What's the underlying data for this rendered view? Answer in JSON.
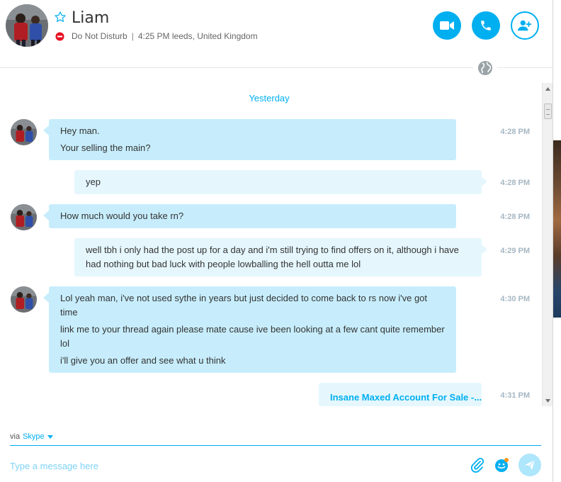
{
  "header": {
    "contact_name": "Liam",
    "status": "Do Not Disturb",
    "separator": "|",
    "local_time": "4:25 PM leeds, United Kingdom",
    "icons": {
      "favorite": "star-outline-icon",
      "status": "do-not-disturb-icon",
      "video": "video-camera-icon",
      "call": "phone-icon",
      "add_people": "add-person-icon",
      "globe": "globe-icon"
    }
  },
  "conversation": {
    "day_label": "Yesterday",
    "messages": [
      {
        "from": "Liam",
        "lines": [
          "Hey man.",
          "Your selling the main?"
        ],
        "time": "4:28 PM"
      },
      {
        "from": "me",
        "lines": [
          "yep"
        ],
        "time": "4:28 PM"
      },
      {
        "from": "Liam",
        "lines": [
          "How much would you take rn?"
        ],
        "time": "4:28 PM"
      },
      {
        "from": "me",
        "lines": [
          "well tbh i only had the post up for a day and i'm still trying to find offers on it, although i have had nothing but bad luck with people lowballing the hell outta me lol"
        ],
        "time": "4:29 PM"
      },
      {
        "from": "Liam",
        "lines": [
          "Lol yeah man, i've not used sythe in years but just decided to come back to rs now i've got time",
          "link me to your thread again please mate cause ive been looking at a few cant quite remember lol",
          "i'll give you an offer and see what u think"
        ],
        "time": "4:30 PM"
      },
      {
        "from": "me",
        "lines": [
          "Insane Maxed Account For Sale -..."
        ],
        "time": "4:31 PM"
      }
    ]
  },
  "composer": {
    "via_label": "via",
    "via_service": "Skype",
    "placeholder": "Type a message here",
    "icons": {
      "attach": "paperclip-icon",
      "emoji": "emoticon-icon",
      "send": "send-icon"
    }
  },
  "colors": {
    "accent": "#00aff0",
    "incoming_bubble": "#c7edfc",
    "outgoing_bubble": "#e5f7fd",
    "timestamp": "#a6b7c2",
    "dnd_red": "#e81123"
  }
}
